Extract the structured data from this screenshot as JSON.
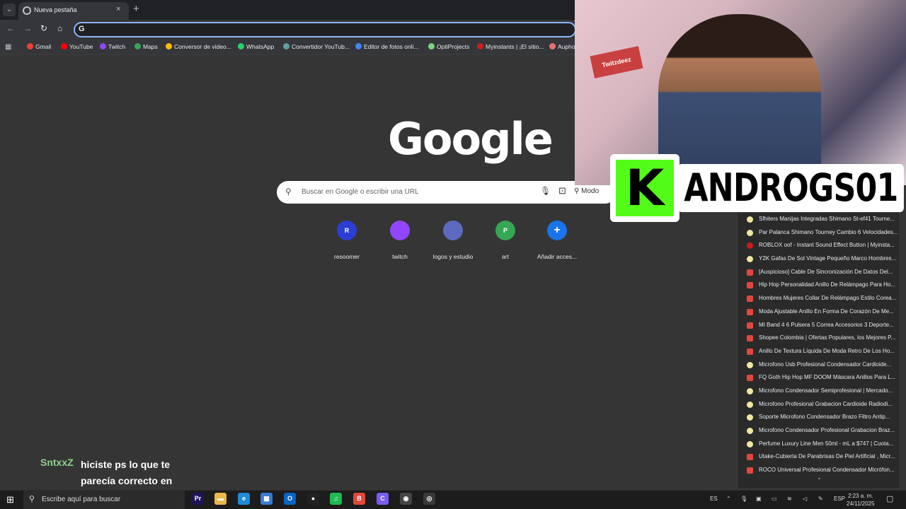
{
  "browser": {
    "tab_title": "Nueva pestaña",
    "tab_close": "×",
    "new_tab": "+",
    "tab_search": "⌄",
    "omnibox_icon": "G",
    "nav": {
      "back": "←",
      "forward": "→",
      "reload": "↻",
      "home": "⌂"
    },
    "bookmarks": [
      {
        "label": "Gmail",
        "color": "#ea4335"
      },
      {
        "label": "YouTube",
        "color": "#ff0000"
      },
      {
        "label": "Twitch",
        "color": "#9146ff"
      },
      {
        "label": "Maps",
        "color": "#34a853"
      },
      {
        "label": "Conversor de video...",
        "color": "#fbbc04"
      },
      {
        "label": "WhatsApp",
        "color": "#25d366"
      },
      {
        "label": "Convertidor YouTub...",
        "color": "#5f9ea0"
      },
      {
        "label": "Editor de fotos onli...",
        "color": "#4285f4"
      },
      {
        "label": "OptiProjects",
        "color": "#7cd47c"
      },
      {
        "label": "Myinstants | ¡El sitio...",
        "color": "#c81e1e"
      },
      {
        "label": "Aupho",
        "color": "#e57373"
      }
    ]
  },
  "google": {
    "logo": "Google",
    "search_placeholder": "Buscar en Google o escribir una URL",
    "mode_label": "Modo",
    "shortcuts": [
      {
        "initial": "R",
        "label": "resoomer",
        "color": "#2b3fd6"
      },
      {
        "initial": "",
        "label": "twitch",
        "color": "#9146ff"
      },
      {
        "initial": "",
        "label": "logos y estudio",
        "color": "#5c6bc0"
      },
      {
        "initial": "P",
        "label": "art",
        "color": "#34a853"
      },
      {
        "initial": "+",
        "label": "Añadir acces...",
        "color": "#1a73e8"
      }
    ]
  },
  "stream": {
    "poster_text": "Twitzdeez",
    "kick_letter": "K",
    "streamer_name": "ANDROGS01",
    "chat_user": "SntxxZ",
    "chat_message": "hiciste ps lo que te parecía correcto en ese momento Bro"
  },
  "history": [
    {
      "title": "Sfhiters Manijas Integradas Shimano St-ef41 Tourne...",
      "icon": "yel"
    },
    {
      "title": "Par Palanca Shimano Tourney Cambio 6 Velocidades...",
      "icon": "yel"
    },
    {
      "title": "ROBLOX oof - Instant Sound Effect Button | Myinsta...",
      "icon": "dred"
    },
    {
      "title": "Y2K Gafas De Sol Vintage Pequeño Marco Hombres...",
      "icon": "yel"
    },
    {
      "title": "[Auspicioso] Cable De Sincronización De Datos Del...",
      "icon": "red"
    },
    {
      "title": "Hip Hop Personalidad Anillo De Relámpago Para Ho...",
      "icon": "red"
    },
    {
      "title": "Hombres Mujeres Collar De Relámpago Estilo Corea...",
      "icon": "red"
    },
    {
      "title": "Moda Ajustable Anillo En Forma De Corazón De Me...",
      "icon": "red"
    },
    {
      "title": "MI Band 4 6 Pulsera 5 Correa Accesorios 3 Deporte...",
      "icon": "red"
    },
    {
      "title": "Shopee Colombia | Ofertas Populares, los Mejores P...",
      "icon": "red"
    },
    {
      "title": "Anillo De Textura Líquida De Moda Retro De Los Ho...",
      "icon": "red"
    },
    {
      "title": "Microfono Usb Profesional Condensador Cardioide...",
      "icon": "yel"
    },
    {
      "title": "FQ Goth Hip Hop MF DOOM Máscara Anillos Para L...",
      "icon": "red"
    },
    {
      "title": "Microfono Condensador Semiprofesional | Mercado...",
      "icon": "yel"
    },
    {
      "title": "Microfono Profesional Grabacion Cardioide Radiodi...",
      "icon": "yel"
    },
    {
      "title": "Soporte Microfono Condensador Brazo Filtro Antip...",
      "icon": "yel"
    },
    {
      "title": "Microfono Condensador Profesional Grabacion Braz...",
      "icon": "yel"
    },
    {
      "title": "Perfume Luxury Line Men 50ml - mL a $747 | Cuota...",
      "icon": "yel"
    },
    {
      "title": "Utake-Cubierta De Parabrisas De Piel Artificial , Micr...",
      "icon": "red"
    },
    {
      "title": "ROCO Universal Profesional Condensador Micrófon...",
      "icon": "red"
    }
  ],
  "history_more": "⌄",
  "taskbar": {
    "start": "⊞",
    "search_placeholder": "Escribe aquí para buscar",
    "apps": [
      {
        "name": "premiere-icon",
        "label": "Pr",
        "color": "#1f1457"
      },
      {
        "name": "file-explorer-icon",
        "label": "▬",
        "color": "#e8b84a"
      },
      {
        "name": "edge-icon",
        "label": "e",
        "color": "#1f8ad6"
      },
      {
        "name": "store-icon",
        "label": "▦",
        "color": "#3a7bd5"
      },
      {
        "name": "outlook-icon",
        "label": "O",
        "color": "#0a64c2"
      },
      {
        "name": "obs-icon",
        "label": "●",
        "color": "#222222"
      },
      {
        "name": "spotify-icon",
        "label": "♫",
        "color": "#1db954"
      },
      {
        "name": "brave-icon",
        "label": "B",
        "color": "#e0483a"
      },
      {
        "name": "copilot-icon",
        "label": "C",
        "color": "#7a5cf0"
      },
      {
        "name": "recorder-icon",
        "label": "◉",
        "color": "#444444"
      },
      {
        "name": "chrome-icon",
        "label": "◎",
        "color": "#3a3a3a"
      }
    ],
    "lang_left": "ES",
    "lang_right": "ESP",
    "time": "2:23 a. m.",
    "date": "24/11/2025"
  }
}
